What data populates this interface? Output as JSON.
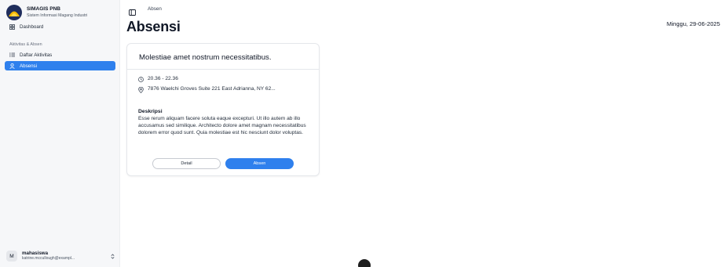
{
  "brand": {
    "title": "SIMAGIS PNB",
    "subtitle": "Sistem Informasi Magang Industri"
  },
  "sidebar": {
    "dashboard_label": "Dashboard",
    "group_label": "Aktivitas & Absen",
    "items": [
      {
        "label": "Daftar Aktivitas",
        "icon": "list-icon",
        "active": false
      },
      {
        "label": "Absensi",
        "icon": "user-icon",
        "active": true
      }
    ]
  },
  "user": {
    "initial": "M",
    "name": "mahasiswa",
    "email": "katrine.mccullough@exampl..."
  },
  "header": {
    "breadcrumb": "Absen",
    "title": "Absensi",
    "date": "Minggu, 29-06-2025"
  },
  "card": {
    "title": "Molestiae amet nostrum necessitatibus.",
    "time": "20.36 - 22.36",
    "location": "7876 Waelchi Groves Suite 221 East Adrianna, NY 62...",
    "description_label": "Deskripsi",
    "description": "Esse rerum aliquam facere soluta eaque excepturi. Ut illo autem ab illo accusamus sed similique. Architecto dolore amet magnam necessitatibus dolorem error quod sunt. Quia molestiae est hic nesciunt dolor voluptas.",
    "detail_label": "Detail",
    "absen_label": "Absen"
  },
  "colors": {
    "accent": "#2f80ed",
    "logo_bg": "#1f2d5c",
    "logo_gold": "#f5b800"
  }
}
